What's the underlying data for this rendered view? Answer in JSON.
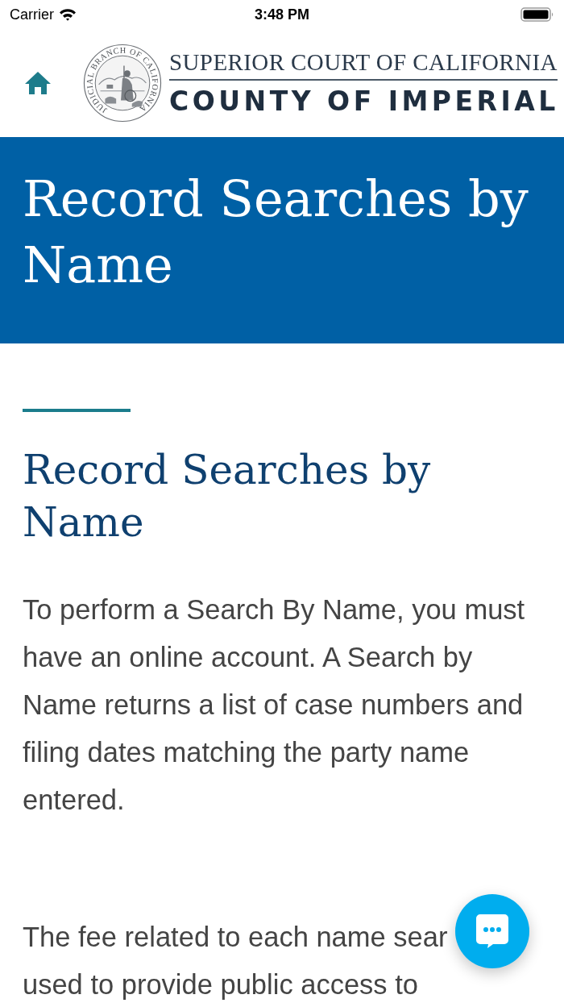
{
  "status_bar": {
    "carrier": "Carrier",
    "time": "3:48 PM"
  },
  "header": {
    "seal_text": "JUDICIAL BRANCH OF CALIFORNIA",
    "court_name": "SUPERIOR COURT OF CALIFORNIA",
    "county_name": "COUNTY OF IMPERIAL"
  },
  "banner": {
    "title": "Record Searches by Name"
  },
  "article": {
    "heading": "Record Searches by Name",
    "paragraphs": [
      {
        "lines": [
          "To perform a Search By Name, you must have an online account. A Search by Name returns a list of case numbers and filing dates matching the party name entered."
        ]
      },
      {
        "lines": [
          "The fee related to each name sear",
          "used to provide public access to"
        ]
      }
    ]
  }
}
